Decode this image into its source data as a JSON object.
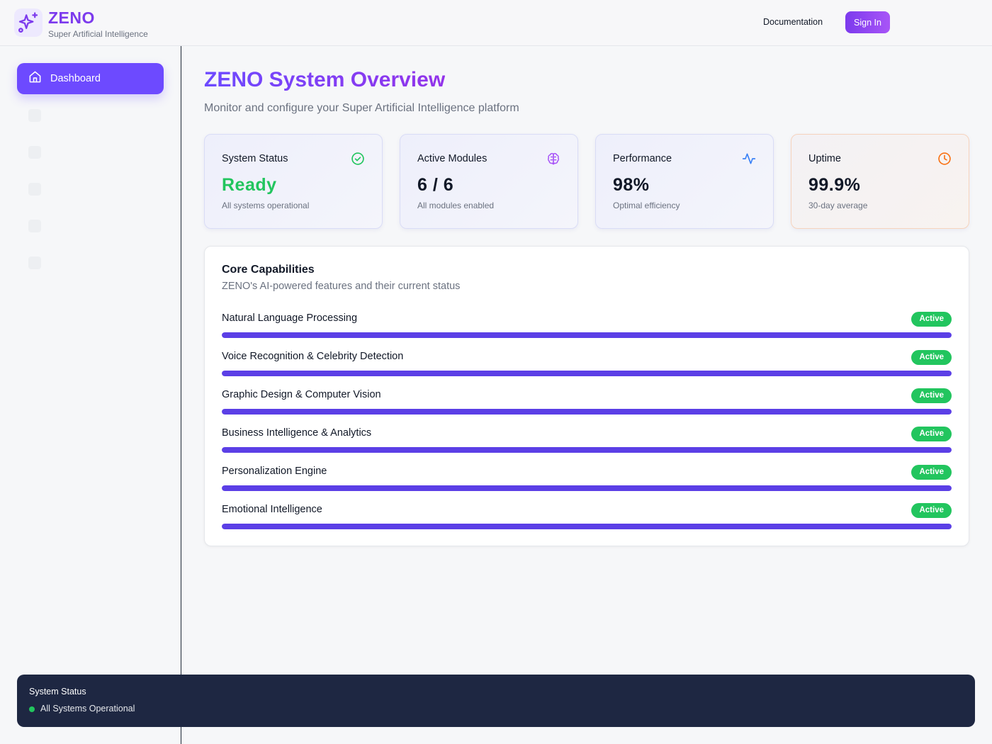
{
  "header": {
    "brand_name": "ZENO",
    "brand_subtitle": "Super Artificial Intelligence",
    "logo_icon": "sparkles-icon",
    "documentation_label": "Documentation",
    "signin_label": "Sign In",
    "accent_color": "#7c3aed"
  },
  "sidebar": {
    "active_item": {
      "label": "Dashboard",
      "icon": "home-icon"
    }
  },
  "main": {
    "title": "ZENO System Overview",
    "subtitle": "Monitor and configure your Super Artificial Intelligence platform",
    "stats": [
      {
        "title": "System Status",
        "value": "Ready",
        "desc": "All systems operational",
        "icon": "check-circle-icon",
        "icon_color": "#22c55e"
      },
      {
        "title": "Active Modules",
        "value": "6 / 6",
        "desc": "All modules enabled",
        "icon": "brain-icon",
        "icon_color": "#a855f7"
      },
      {
        "title": "Performance",
        "value": "98%",
        "desc": "Optimal efficiency",
        "icon": "activity-icon",
        "icon_color": "#3b82f6"
      },
      {
        "title": "Uptime",
        "value": "99.9%",
        "desc": "30-day average",
        "icon": "clock-icon",
        "icon_color": "#f97316"
      }
    ],
    "capabilities": {
      "title": "Core Capabilities",
      "subtitle": "ZENO's AI-powered features and their current status",
      "items": [
        {
          "name": "Natural Language Processing",
          "status": "Active",
          "progress": 1.0
        },
        {
          "name": "Voice Recognition & Celebrity Detection",
          "status": "Active",
          "progress": 1.0
        },
        {
          "name": "Graphic Design & Computer Vision",
          "status": "Active",
          "progress": 1.0
        },
        {
          "name": "Business Intelligence & Analytics",
          "status": "Active",
          "progress": 1.0
        },
        {
          "name": "Personalization Engine",
          "status": "Active",
          "progress": 1.0
        },
        {
          "name": "Emotional Intelligence",
          "status": "Active",
          "progress": 1.0
        }
      ]
    }
  },
  "status_bar": {
    "title": "System Status",
    "text": "All Systems Operational",
    "dot_color": "#22c55e"
  }
}
